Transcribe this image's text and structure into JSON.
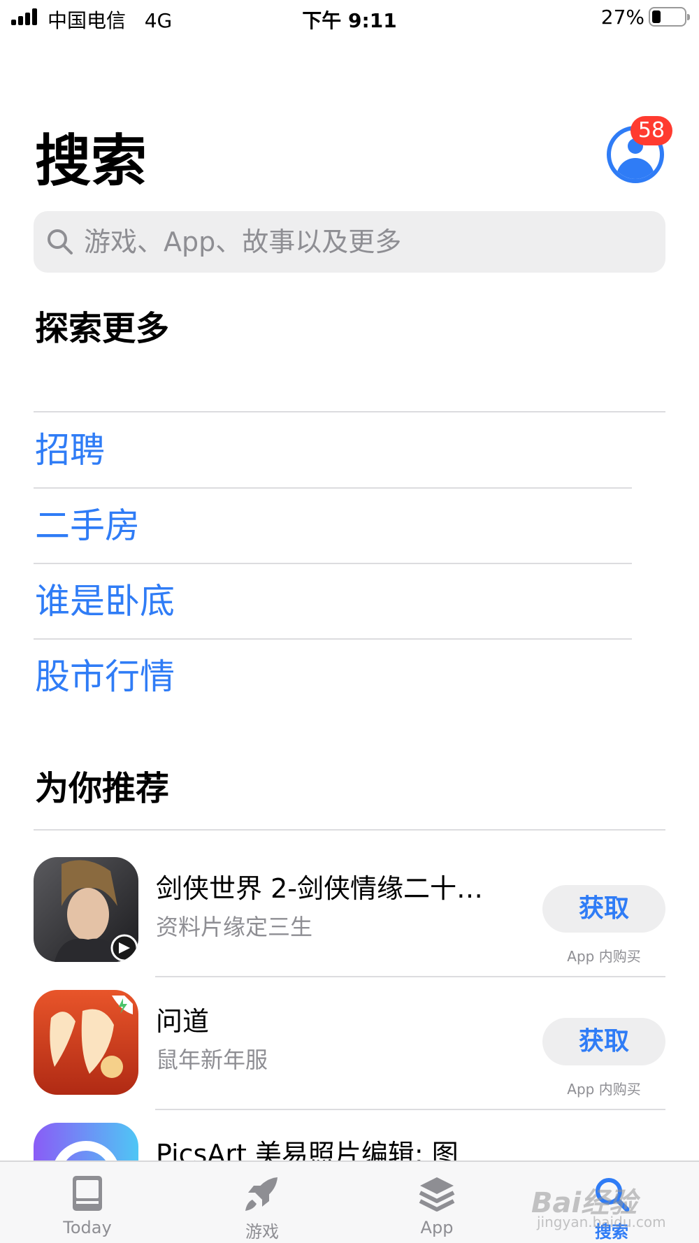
{
  "status_bar": {
    "carrier": "中国电信",
    "network": "4G",
    "time": "下午 9:11",
    "battery_percent": "27%",
    "battery_level": 0.27
  },
  "header": {
    "title": "搜索",
    "badge_count": "58",
    "accent_color": "#2f7cf6",
    "badge_color": "#ff3b30"
  },
  "search": {
    "placeholder": "游戏、App、故事以及更多",
    "value": ""
  },
  "explore": {
    "title": "探索更多",
    "items": [
      {
        "label": "招聘"
      },
      {
        "label": "二手房"
      },
      {
        "label": "谁是卧底"
      },
      {
        "label": "股市行情"
      }
    ]
  },
  "recommended": {
    "title": "为你推荐",
    "apps": [
      {
        "name": "剑侠世界 2-剑侠情缘二十…",
        "subtitle": "资料片缘定三生",
        "button": "获取",
        "note": "App 内购买",
        "icon": "game-warrior-icon"
      },
      {
        "name": "问道",
        "subtitle": "鼠年新年服",
        "button": "获取",
        "note": "App 内购买",
        "icon": "wendao-game-icon"
      },
      {
        "name": "PicsArt 美易照片编辑: 图",
        "subtitle": "",
        "button": "",
        "note": "",
        "icon": "picsart-icon"
      }
    ]
  },
  "tab_bar": {
    "tabs": [
      {
        "label": "Today",
        "icon": "today-icon"
      },
      {
        "label": "游戏",
        "icon": "rocket-icon"
      },
      {
        "label": "App",
        "icon": "layers-icon"
      },
      {
        "label": "搜索",
        "icon": "search-icon",
        "active": true
      }
    ]
  },
  "watermark": {
    "text": "Bai经验",
    "sub": "jingyan.baidu.com"
  }
}
